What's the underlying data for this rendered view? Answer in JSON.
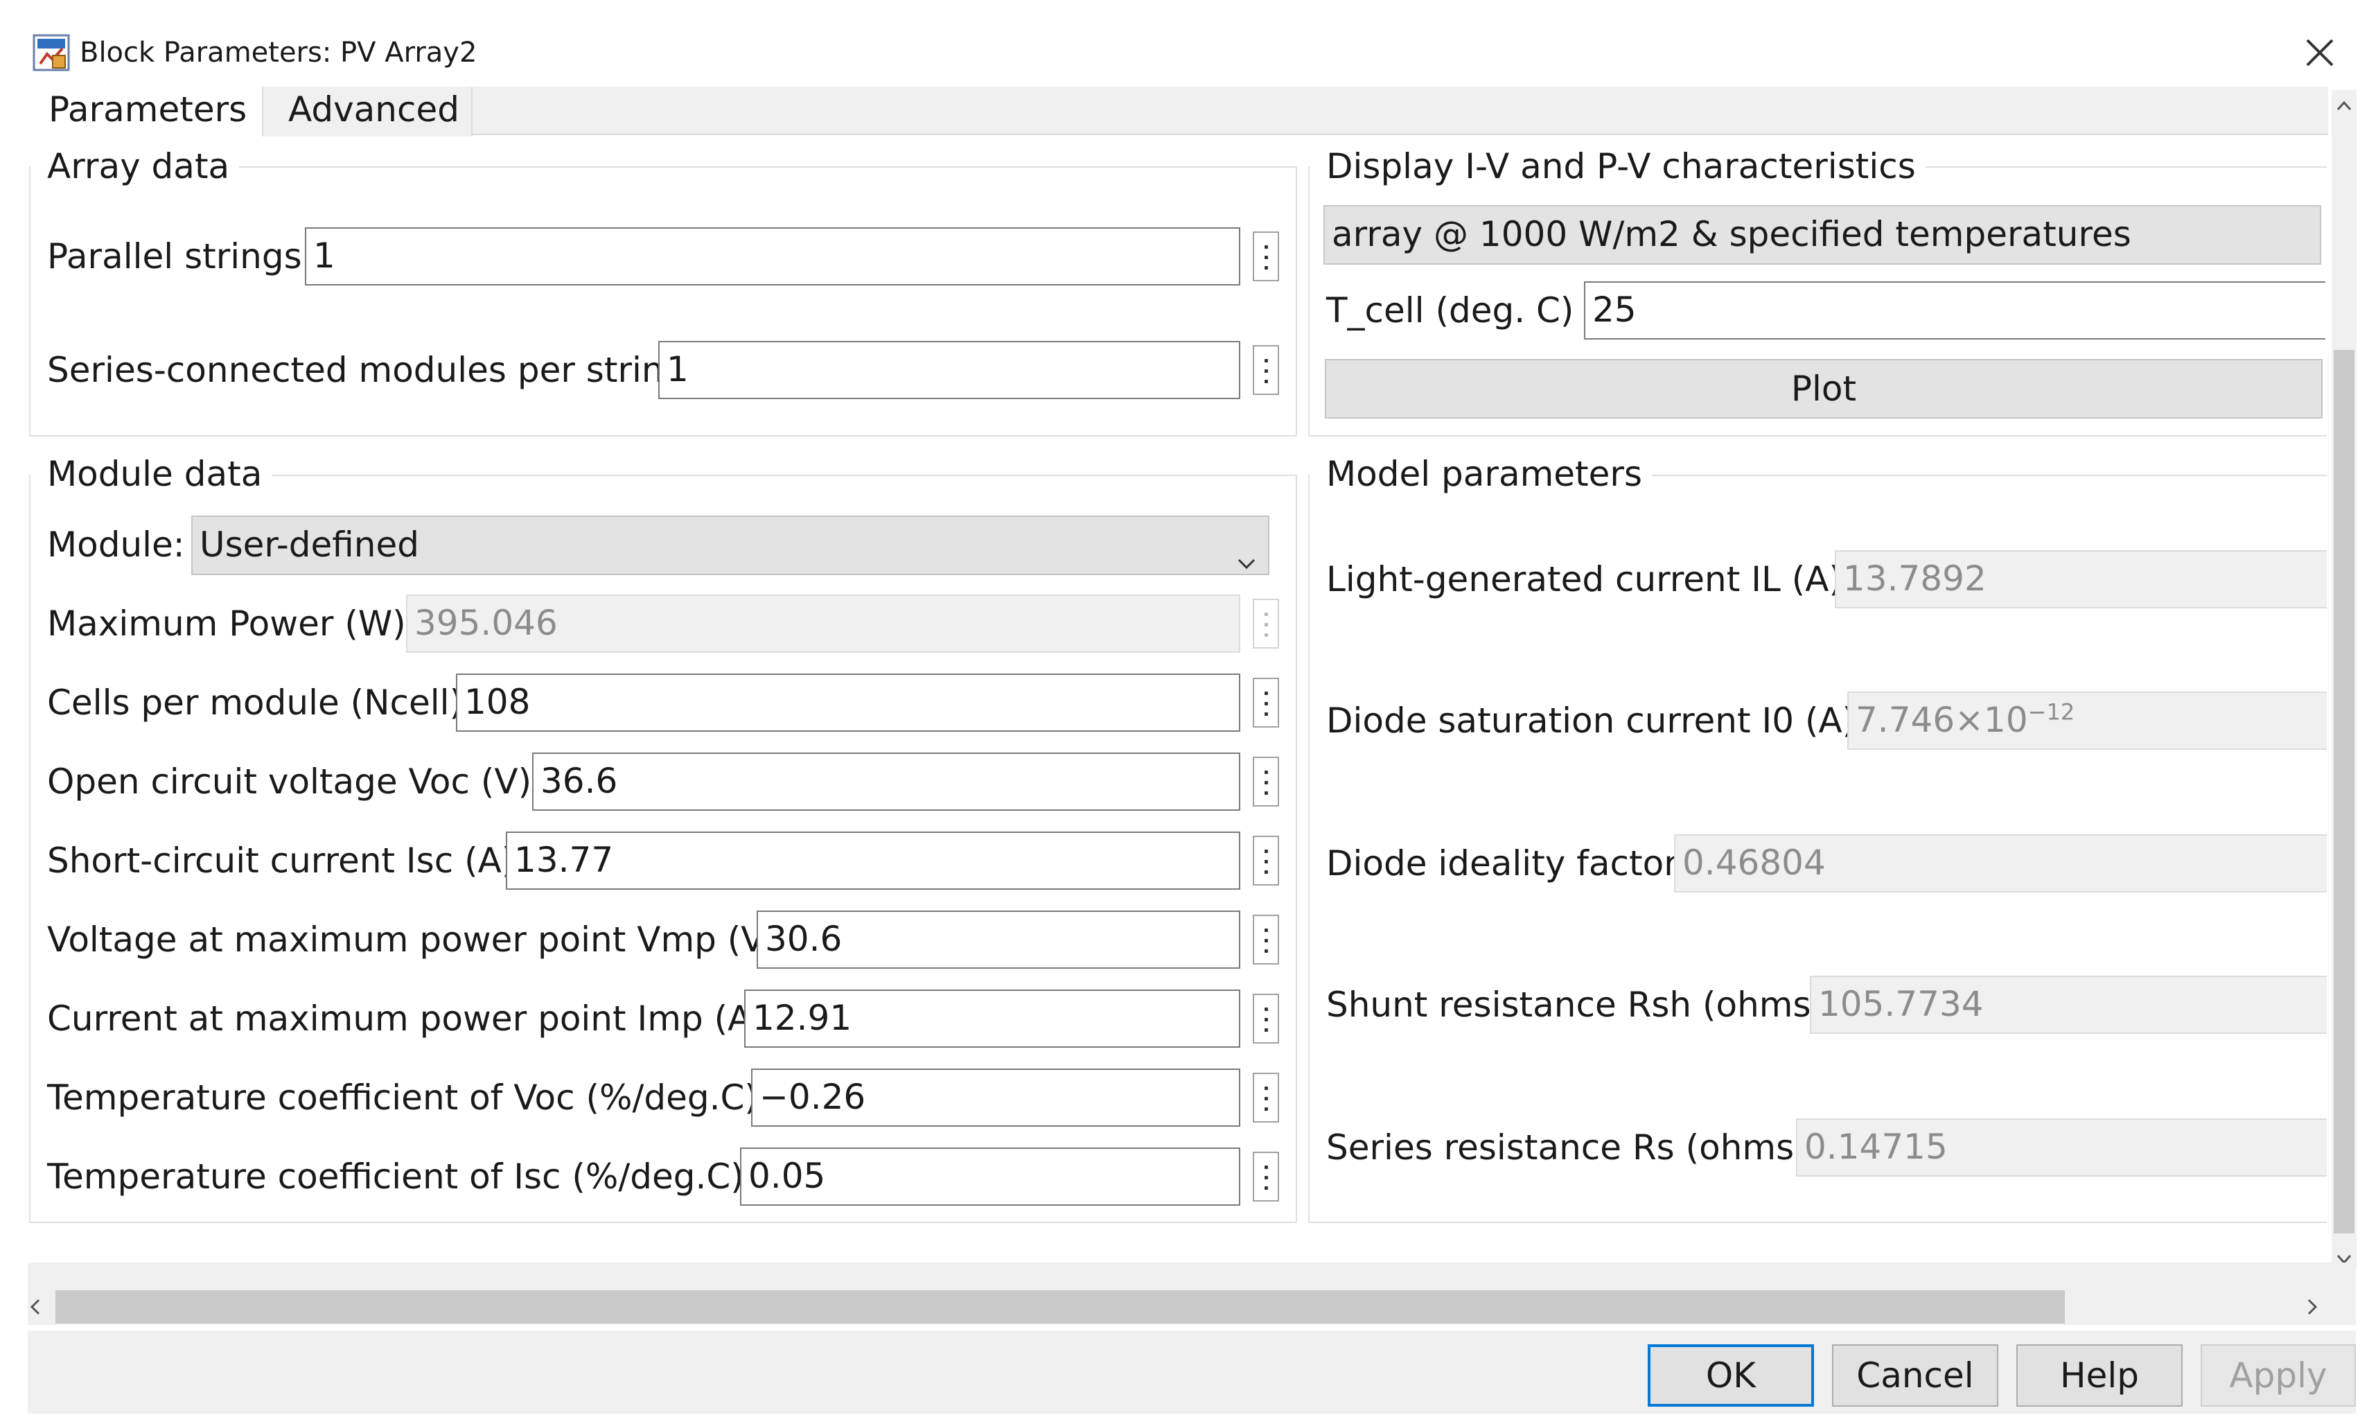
{
  "window": {
    "title": "Block Parameters: PV Array2"
  },
  "tabs": [
    {
      "label": "Parameters",
      "active": true
    },
    {
      "label": "Advanced",
      "active": false
    }
  ],
  "array_data": {
    "legend": "Array data",
    "parallel_strings": {
      "label": "Parallel strings",
      "value": "1"
    },
    "series_modules": {
      "label": "Series-connected modules per string",
      "value": "1"
    }
  },
  "module_data": {
    "legend": "Module data",
    "module": {
      "label": "Module:",
      "value": "User-defined"
    },
    "max_power": {
      "label": "Maximum Power (W)",
      "value": "395.046"
    },
    "cells": {
      "label": "Cells per module (Ncell)",
      "value": "108"
    },
    "voc": {
      "label": "Open circuit voltage  Voc (V)",
      "value": "36.6"
    },
    "isc": {
      "label": "Short-circuit current Isc (A)",
      "value": "13.77"
    },
    "vmp": {
      "label": "Voltage at maximum power point Vmp (V)",
      "value": "30.6"
    },
    "imp": {
      "label": "Current at maximum power point Imp (A)",
      "value": "12.91"
    },
    "temp_voc": {
      "label": "Temperature coefficient of Voc (%/deg.C)",
      "value": "−0.26"
    },
    "temp_isc": {
      "label": "Temperature coefficient of Isc (%/deg.C)",
      "value": "0.05"
    }
  },
  "display": {
    "legend": "Display  I-V and P-V characteristics",
    "selection": "array @ 1000 W/m2 & specified temperatures",
    "tcell": {
      "label": "T_cell (deg. C)",
      "value": "25"
    },
    "plot_label": "Plot"
  },
  "model_params": {
    "legend": "Model parameters",
    "il": {
      "label": "Light-generated current IL (A)",
      "value": "13.7892"
    },
    "i0": {
      "label": "Diode saturation current I0 (A)",
      "mantissa": "7.746",
      "times": "×",
      "base": "10",
      "exponent": "−12"
    },
    "ideality": {
      "label": "Diode ideality factor",
      "value": "0.46804"
    },
    "rsh": {
      "label": "Shunt resistance Rsh (ohms)",
      "value": "105.7734"
    },
    "rs": {
      "label": "Series resistance Rs (ohms)",
      "value": "0.14715"
    }
  },
  "buttons": {
    "ok": "OK",
    "cancel": "Cancel",
    "help": "Help",
    "apply": "Apply"
  },
  "icons": [
    "simulink-block-icon",
    "close-icon",
    "chevron-down-icon",
    "more-options-icon",
    "scroll-up-icon",
    "scroll-down-icon",
    "scroll-left-icon",
    "scroll-right-icon"
  ],
  "colors": {
    "ok_border": "#0078d7",
    "disabled_text": "#8c8c8c",
    "panel_bg": "#f0f0f0"
  }
}
